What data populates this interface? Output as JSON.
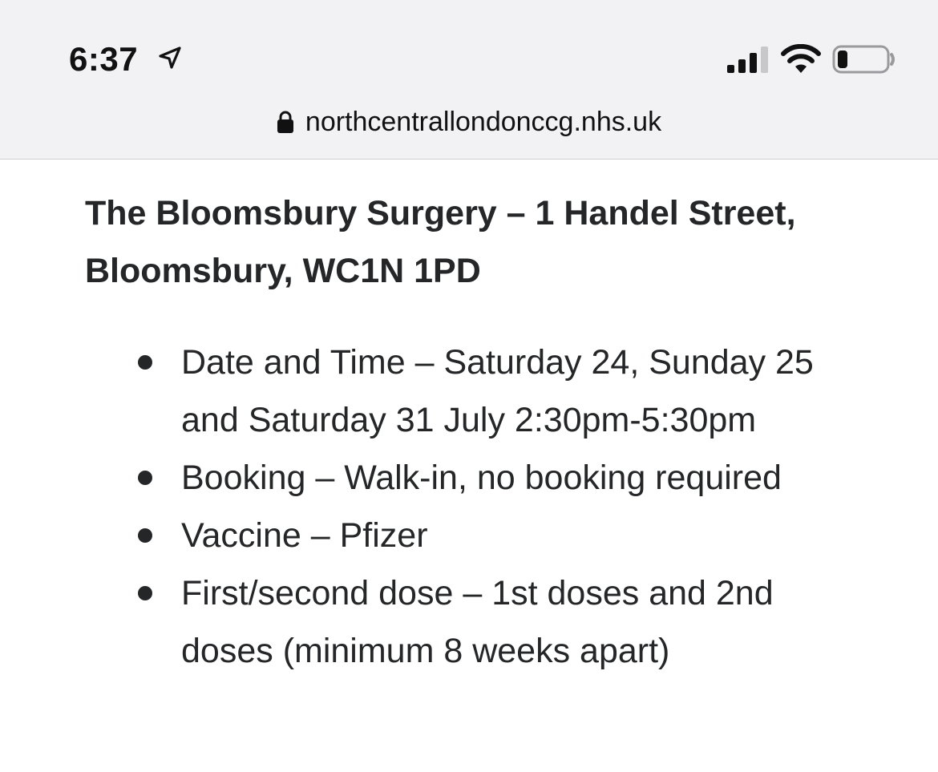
{
  "status_bar": {
    "time": "6:37",
    "location_icon": "location-arrow-icon",
    "signal_icon": "cellular-signal-icon",
    "wifi_icon": "wifi-icon",
    "battery_icon": "battery-low-icon",
    "battery_level": 0.2
  },
  "address_bar": {
    "lock_icon": "lock-icon",
    "url": "northcentrallondonccg.nhs.uk"
  },
  "page": {
    "heading": "The Bloomsbury Surgery – 1 Handel Street, Bloomsbury, WC1N 1PD",
    "details": [
      {
        "text": "Date and Time – Saturday 24, Sunday 25 and Saturday 31 July 2:30pm-5:30pm"
      },
      {
        "text": "Booking – Walk-in, no booking required"
      },
      {
        "text": "Vaccine – Pfizer"
      },
      {
        "text": "First/second dose – 1st doses and 2nd doses (minimum 8 weeks apart)"
      }
    ]
  }
}
